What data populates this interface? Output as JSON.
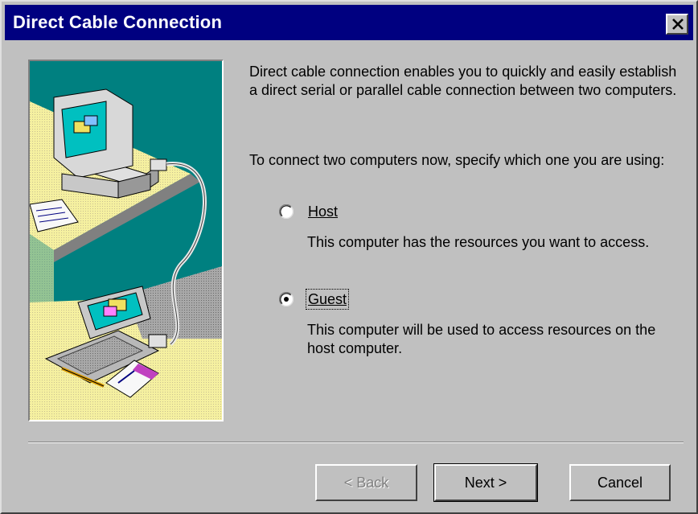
{
  "window": {
    "title": "Direct Cable Connection",
    "close_icon": "close-icon"
  },
  "content": {
    "intro": "Direct cable connection enables you to quickly and easily establish a direct serial or parallel cable connection between two computers.",
    "instruction": "To connect two computers now, specify which one you are using:",
    "options": [
      {
        "label": "Host",
        "description": "This computer has the resources you want to access.",
        "selected": false
      },
      {
        "label": "Guest",
        "description": "This computer will be used to access resources on the host computer.",
        "selected": true
      }
    ]
  },
  "buttons": {
    "back": "< Back",
    "next": "Next >",
    "cancel": "Cancel"
  },
  "colors": {
    "titlebar": "#000080",
    "face": "#c0c0c0",
    "illustration_teal": "#008080",
    "illustration_yellow": "#f0e68c"
  }
}
